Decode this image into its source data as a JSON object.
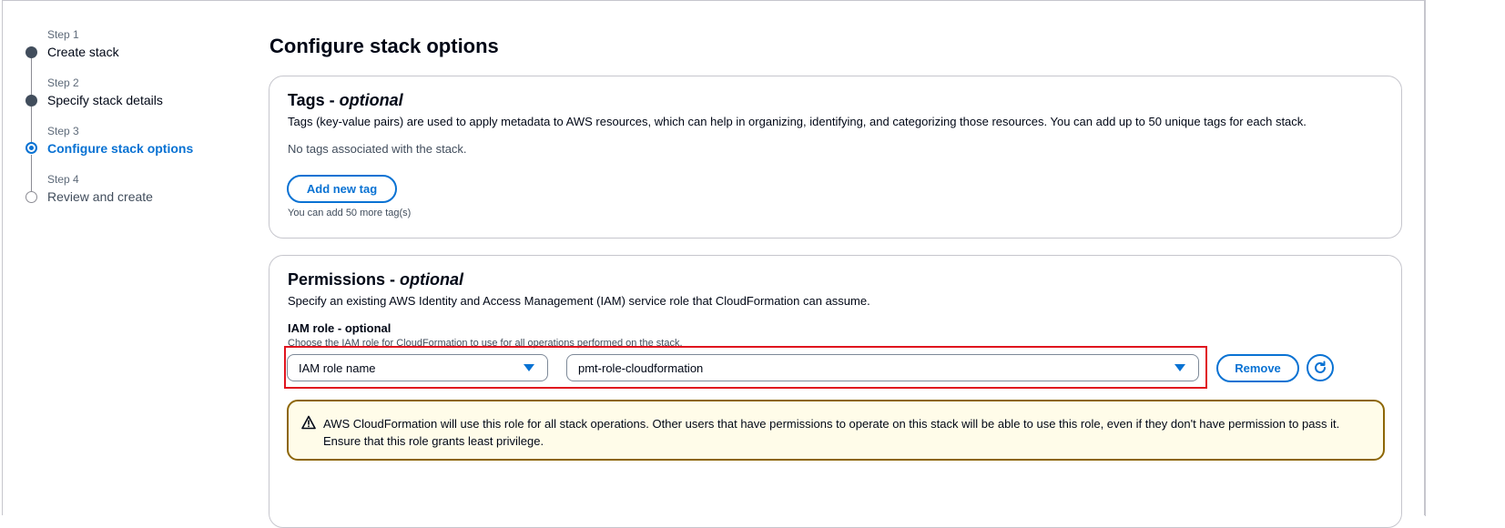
{
  "steps": [
    {
      "num": "Step 1",
      "label": "Create stack",
      "state": "done"
    },
    {
      "num": "Step 2",
      "label": "Specify stack details",
      "state": "done"
    },
    {
      "num": "Step 3",
      "label": "Configure stack options",
      "state": "current"
    },
    {
      "num": "Step 4",
      "label": "Review and create",
      "state": "pending"
    }
  ],
  "page_title": "Configure stack options",
  "tags": {
    "title": "Tags - ",
    "title_optional": "optional",
    "description": "Tags (key-value pairs) are used to apply metadata to AWS resources, which can help in organizing, identifying, and categorizing those resources. You can add up to 50 unique tags for each stack.",
    "empty_text": "No tags associated with the stack.",
    "add_button": "Add new tag",
    "remaining": "You can add 50 more tag(s)"
  },
  "permissions": {
    "title": "Permissions - ",
    "title_optional": "optional",
    "description": "Specify an existing AWS Identity and Access Management (IAM) service role that CloudFormation can assume.",
    "field_label": "IAM role - optional",
    "field_hint": "Choose the IAM role for CloudFormation to use for all operations performed on the stack.",
    "type_select": "IAM role name",
    "role_select": "pmt-role-cloudformation",
    "remove_button": "Remove",
    "alert": "AWS CloudFormation will use this role for all stack operations. Other users that have permissions to operate on this stack will be able to use this role, even if they don't have permission to pass it. Ensure that this role grants least privilege."
  },
  "colors": {
    "accent": "#0972d3",
    "warning_border": "#8d6605",
    "warning_bg": "#fffce9",
    "highlight": "#e0141e"
  },
  "icons": [
    "warning-icon",
    "refresh-icon",
    "caret-down-icon"
  ]
}
